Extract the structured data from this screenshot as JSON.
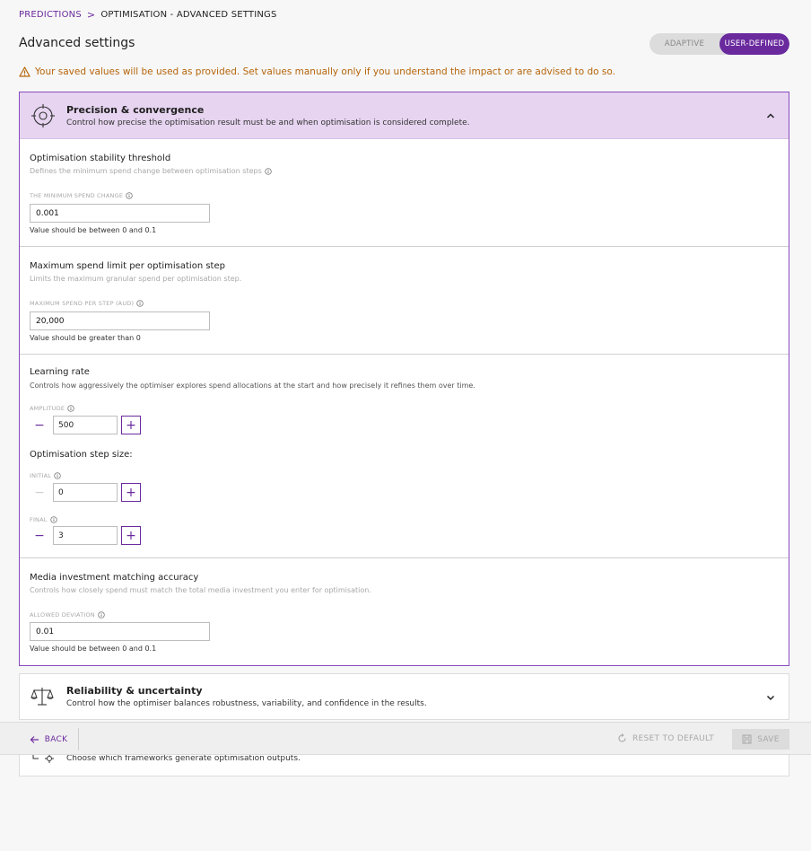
{
  "breadcrumb": {
    "parent": "PREDICTIONS",
    "separator": ">",
    "current": "OPTIMISATION - ADVANCED SETTINGS"
  },
  "page": {
    "title": "Advanced settings"
  },
  "mode_toggle": {
    "adaptive": "ADAPTIVE",
    "user_defined": "USER-DEFINED",
    "active": "USER-DEFINED"
  },
  "warning": {
    "text": "Your saved values will be used as provided. Set values manually only if you understand the impact or are advised to do so.",
    "color": "#b5650b"
  },
  "panels": {
    "precision": {
      "title": "Precision & convergence",
      "description": "Control how precise the optimisation result must be and when optimisation is considered complete.",
      "icon": "target-icon",
      "expanded": true,
      "stability": {
        "title": "Optimisation stability threshold",
        "description": "Defines the minimum spend change between optimisation steps",
        "field_label": "THE MINIMUM SPEND CHANGE",
        "value": "0.001",
        "hint": "Value should be between 0 and 0.1"
      },
      "max_spend": {
        "title": "Maximum spend limit per optimisation step",
        "description": "Limits the maximum granular spend per optimisation step.",
        "field_label": "MAXIMUM SPEND PER STEP (AUD)",
        "value": "20,000",
        "hint": "Value should be greater than 0"
      },
      "learning_rate": {
        "title": "Learning rate",
        "description": "Controls how aggressively the optimiser explores spend allocations at the start and how precisely it refines them over time.",
        "amplitude_label": "AMPLITUDE",
        "amplitude_value": "500",
        "step_size_title": "Optimisation step size:",
        "initial_label": "INITIAL",
        "initial_value": "0",
        "final_label": "FINAL",
        "final_value": "3"
      },
      "matching": {
        "title": "Media investment matching accuracy",
        "description": "Controls how closely spend must match the total media investment you enter for optimisation.",
        "field_label": "ALLOWED DEVIATION",
        "value": "0.01",
        "hint": "Value should be between 0 and 0.1"
      }
    },
    "reliability": {
      "title": "Reliability & uncertainty",
      "description": "Control how the optimiser balances robustness, variability, and confidence in the results.",
      "icon": "balance-scale-icon",
      "expanded": false
    },
    "frameworks": {
      "description": "Choose which frameworks generate optimisation outputs.",
      "icon": "framework-gear-icon"
    }
  },
  "footer": {
    "back_label": "BACK",
    "reset_label": "RESET TO DEFAULT",
    "save_label": "SAVE"
  },
  "colors": {
    "accent": "#6a2a9e",
    "header_bg": "#e6d4f0",
    "warning": "#b5650b"
  }
}
